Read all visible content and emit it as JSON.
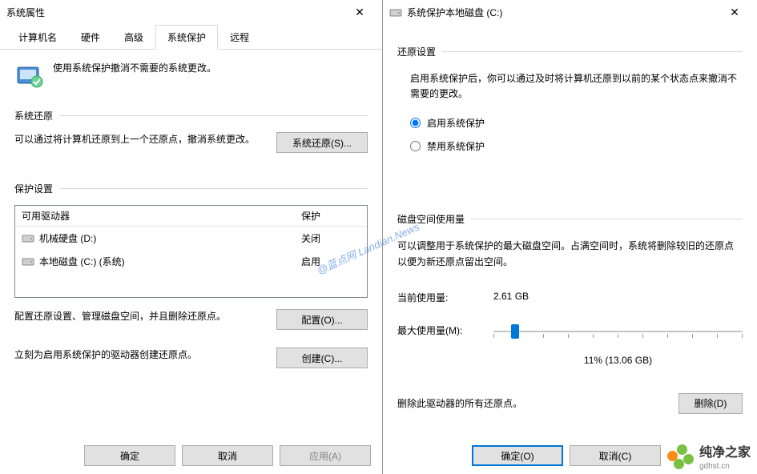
{
  "left": {
    "title": "系统属性",
    "tabs": [
      "计算机名",
      "硬件",
      "高级",
      "系统保护",
      "远程"
    ],
    "active_tab": 3,
    "intro": "使用系统保护撤消不需要的系统更改。",
    "section_restore": {
      "title": "系统还原",
      "desc": "可以通过将计算机还原到上一个还原点，撤消系统更改。",
      "btn": "系统还原(S)..."
    },
    "section_settings": {
      "title": "保护设置",
      "col_drive": "可用驱动器",
      "col_protect": "保护",
      "rows": [
        {
          "name": "机械硬盘 (D:)",
          "status": "关闭"
        },
        {
          "name": "本地磁盘 (C:) (系统)",
          "status": "启用"
        }
      ],
      "config_desc": "配置还原设置、管理磁盘空间，并且删除还原点。",
      "config_btn": "配置(O)...",
      "create_desc": "立刻为启用系统保护的驱动器创建还原点。",
      "create_btn": "创建(C)..."
    },
    "buttons": {
      "ok": "确定",
      "cancel": "取消",
      "apply": "应用(A)"
    }
  },
  "right": {
    "title": "系统保护本地磁盘 (C:)",
    "section_restore": {
      "title": "还原设置",
      "desc": "启用系统保护后，你可以通过及时将计算机还原到以前的某个状态点来撤消不需要的更改。",
      "opt_enable": "启用系统保护",
      "opt_disable": "禁用系统保护",
      "selected": "enable"
    },
    "section_disk": {
      "title": "磁盘空间使用量",
      "desc": "可以调整用于系统保护的最大磁盘空间。占满空间时，系统将删除较旧的还原点以便为新还原点留出空间。",
      "current_label": "当前使用量:",
      "current_value": "2.61 GB",
      "max_label": "最大使用量(M):",
      "slider_percent": 11,
      "slider_text": "11% (13.06 GB)",
      "delete_desc": "删除此驱动器的所有还原点。",
      "delete_btn": "删除(D)"
    },
    "buttons": {
      "ok": "确定(O)",
      "cancel": "取消(C)"
    }
  },
  "watermark": "@蓝点网 Landian.News",
  "logo": {
    "name": "纯净之家",
    "sub": "gdhst.cn"
  }
}
